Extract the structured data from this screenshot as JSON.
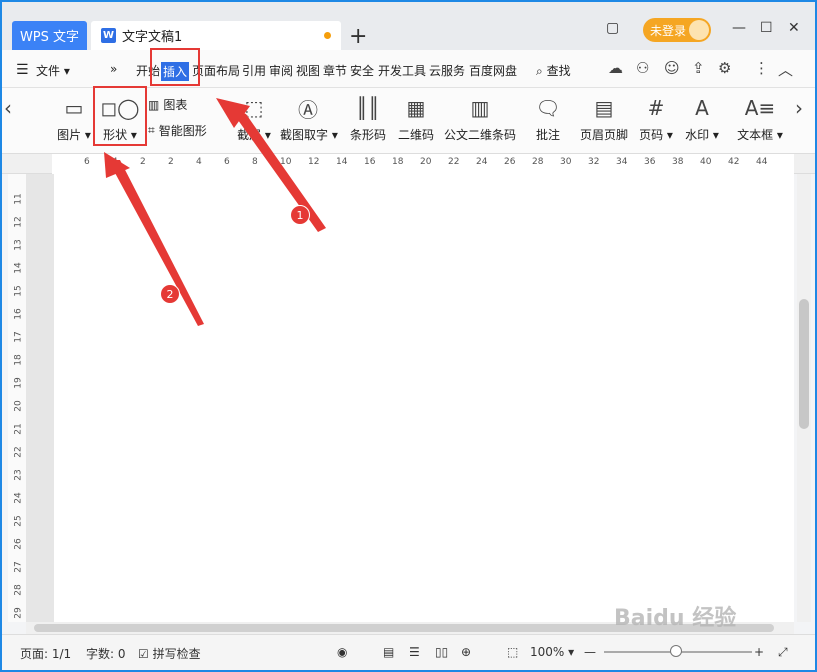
{
  "titlebar": {
    "app_tab": "WPS 文字",
    "doc_tab": "文字文稿1",
    "doc_icon": "W",
    "add_tab": "+",
    "login_label": "未登录",
    "window_controls": [
      "minimize-icon",
      "maximize-icon",
      "close-icon"
    ]
  },
  "menu": {
    "file_label": "文件",
    "more": "»",
    "tabs": [
      "开始",
      "插入",
      "页面布局",
      "引用",
      "审阅",
      "视图",
      "章节",
      "安全",
      "开发工具",
      "云服务",
      "百度网盘"
    ],
    "search_label": "查找"
  },
  "ribbon": {
    "picture": "图片",
    "shape": "形状",
    "chart": "图表",
    "smartart": "智能图形",
    "screenshot": "截屏",
    "ocr": "截图取字",
    "barcode": "条形码",
    "qrcode": "二维码",
    "pdf417": "公文二维条码",
    "comment": "批注",
    "header_footer": "页眉页脚",
    "page_number": "页码",
    "watermark": "水印",
    "textbox": "文本框"
  },
  "ruler": {
    "marks": [
      "6",
      "4",
      "2",
      "2",
      "4",
      "6",
      "8",
      "10",
      "12",
      "14",
      "16",
      "18",
      "20",
      "22",
      "24",
      "26",
      "28",
      "30",
      "32",
      "34",
      "36",
      "38",
      "40",
      "42",
      "44"
    ],
    "vmarks": [
      "11",
      "12",
      "13",
      "14",
      "15",
      "16",
      "17",
      "18",
      "19",
      "20",
      "21",
      "22",
      "23",
      "24",
      "25",
      "26",
      "27",
      "28",
      "29"
    ]
  },
  "status": {
    "page": "页面: 1/1",
    "words": "字数: 0",
    "spell": "拼写检查",
    "zoom": "100%"
  },
  "annotations": {
    "badge1": "1",
    "badge2": "2",
    "color": "#e53935"
  },
  "watermark_text": "Baidu 经验"
}
